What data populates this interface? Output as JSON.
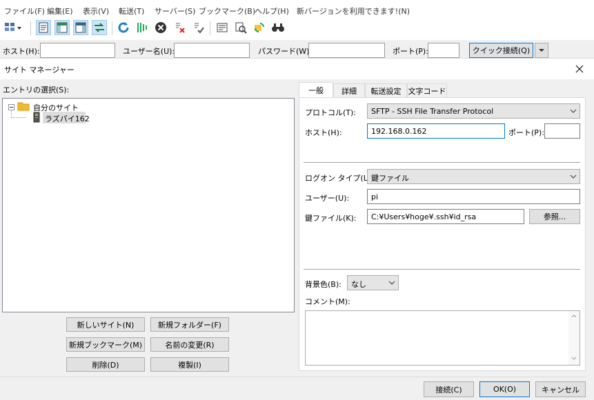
{
  "menu": [
    "ファイル(F)",
    "編集(E)",
    "表示(V)",
    "転送(T)",
    "サーバー(S)",
    "ブックマーク(B)",
    "ヘルプ(H)",
    "新バージョンを利用できます!(N)"
  ],
  "quickconnect": {
    "host_label": "ホスト(H):",
    "user_label": "ユーザー名(U):",
    "password_label": "パスワード(W):",
    "port_label": "ポート(P):",
    "connect_button": "クイック接続(Q)"
  },
  "dialog": {
    "title": "サイト マネージャー",
    "entry_label": "エントリの選択(S):",
    "tree": {
      "folder": "自分のサイト",
      "site": "ラズパイ162"
    },
    "buttons": {
      "new_site": "新しいサイト(N)",
      "new_folder": "新規フォルダー(F)",
      "new_bookmark": "新規ブックマーク(M)",
      "rename": "名前の変更(R)",
      "delete": "削除(D)",
      "duplicate": "複製(I)"
    },
    "tabs": [
      "一般",
      "詳細",
      "転送設定",
      "文字コード"
    ],
    "general": {
      "protocol_label": "プロトコル(T):",
      "protocol_value": "SFTP - SSH File Transfer Protocol",
      "host_label": "ホスト(H):",
      "host_value": "192.168.0.162",
      "port_label": "ポート(P):",
      "port_value": "",
      "logon_label": "ログオン タイプ(L):",
      "logon_value": "鍵ファイル",
      "user_label": "ユーザー(U):",
      "user_value": "pi",
      "keyfile_label": "鍵ファイル(K):",
      "keyfile_value": "C:¥Users¥hoge¥.ssh¥id_rsa",
      "browse_button": "参照...",
      "bgcolor_label": "背景色(B):",
      "bgcolor_value": "なし",
      "comment_label": "コメント(M):",
      "comment_value": ""
    },
    "footer": {
      "connect": "接続(C)",
      "ok": "OK(O)",
      "cancel": "キャンセル"
    }
  }
}
